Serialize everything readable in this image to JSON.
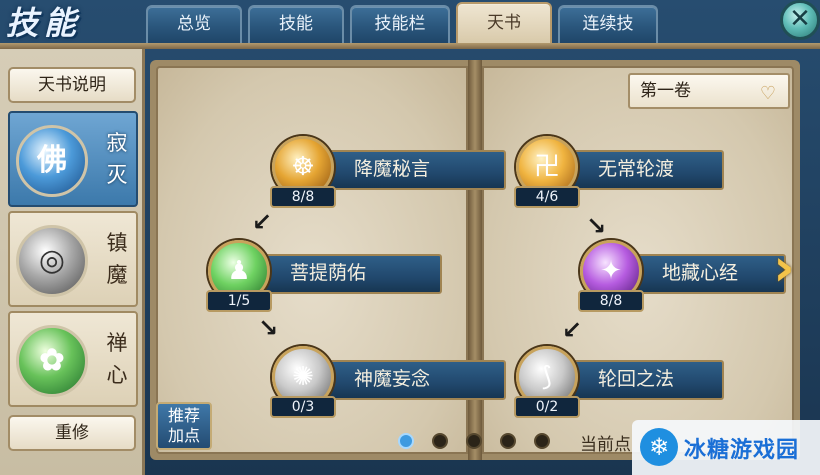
{
  "header": {
    "title": "技能",
    "tabs": [
      {
        "label": "总览",
        "active": false
      },
      {
        "label": "技能",
        "active": false
      },
      {
        "label": "技能栏",
        "active": false
      },
      {
        "label": "天书",
        "active": true
      },
      {
        "label": "连续技",
        "active": false
      }
    ],
    "close_glyph": "✕"
  },
  "sidebar": {
    "explain_label": "天书说明",
    "schools": [
      {
        "label": "寂灭",
        "char1": "寂",
        "char2": "灭",
        "orb_glyph": "佛",
        "active": true,
        "icon": "buddha-orb-icon"
      },
      {
        "label": "镇魔",
        "char1": "镇",
        "char2": "魔",
        "orb_glyph": "◎",
        "active": false,
        "icon": "beads-orb-icon"
      },
      {
        "label": "禅心",
        "char1": "禅",
        "char2": "心",
        "orb_glyph": "✿",
        "active": false,
        "icon": "lotus-orb-icon"
      }
    ],
    "reset_label": "重修"
  },
  "book": {
    "volume_select": "第一卷",
    "volume_chevron": "♡",
    "left_page": [
      {
        "name": "降魔秘言",
        "level": "8/8",
        "icon": "vajra-icon",
        "glyph": "☸"
      },
      {
        "name": "菩提荫佑",
        "level": "1/5",
        "icon": "bodhi-figure-icon",
        "glyph": "♟"
      },
      {
        "name": "神魔妄念",
        "level": "0/3",
        "icon": "demon-thought-icon",
        "glyph": "✺"
      }
    ],
    "right_page": [
      {
        "name": "无常轮渡",
        "level": "4/6",
        "icon": "scroll-icon",
        "glyph": "卍"
      },
      {
        "name": "地藏心经",
        "level": "8/8",
        "icon": "crystal-icon",
        "glyph": "✦"
      },
      {
        "name": "轮回之法",
        "level": "0/2",
        "icon": "wheel-icon",
        "glyph": "⟆"
      }
    ],
    "next_glyph": "›"
  },
  "footer": {
    "recommend_line1": "推荐",
    "recommend_line2": "加点",
    "page_dots": 5,
    "active_dot": 0,
    "current_points_label": "当前点",
    "watermark": "冰糖游戏园",
    "watermark_glyph": "❄"
  },
  "colors": {
    "tab_blue": "#2a567c",
    "tab_active": "#d8c9a9",
    "node_bar": "#21486d",
    "paper": "#e6ddca",
    "accent_gold": "#c8a35c",
    "dot_active": "#3d9ae0"
  }
}
